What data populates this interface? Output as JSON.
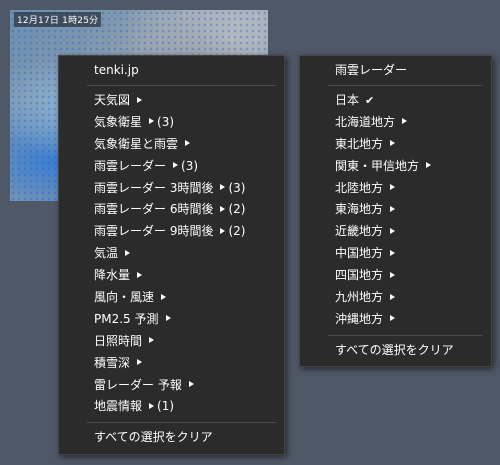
{
  "background_map": {
    "timestamp": "12月17日 1時25分"
  },
  "left_menu": {
    "header": "tenki.jp",
    "items": [
      {
        "label": "天気図",
        "count": ""
      },
      {
        "label": "気象衛星",
        "count": "(3)"
      },
      {
        "label": "気象衛星と雨雲",
        "count": ""
      },
      {
        "label": "雨雲レーダー",
        "count": "(3)"
      },
      {
        "label": "雨雲レーダー 3時間後",
        "count": "(3)"
      },
      {
        "label": "雨雲レーダー 6時間後",
        "count": "(2)"
      },
      {
        "label": "雨雲レーダー 9時間後",
        "count": "(2)"
      },
      {
        "label": "気温",
        "count": ""
      },
      {
        "label": "降水量",
        "count": ""
      },
      {
        "label": "風向・風速",
        "count": ""
      },
      {
        "label": "PM2.5 予測",
        "count": ""
      },
      {
        "label": "日照時間",
        "count": ""
      },
      {
        "label": "積雪深",
        "count": ""
      },
      {
        "label": "雷レーダー 予報",
        "count": ""
      },
      {
        "label": "地震情報",
        "count": "(1)"
      }
    ],
    "footer": "すべての選択をクリア"
  },
  "right_menu": {
    "header": "雨雲レーダー",
    "checked_item": {
      "label": "日本",
      "mark": "✔"
    },
    "items": [
      {
        "label": "北海道地方"
      },
      {
        "label": "東北地方"
      },
      {
        "label": "関東・甲信地方"
      },
      {
        "label": "北陸地方"
      },
      {
        "label": "東海地方"
      },
      {
        "label": "近畿地方"
      },
      {
        "label": "中国地方"
      },
      {
        "label": "四国地方"
      },
      {
        "label": "九州地方"
      },
      {
        "label": "沖縄地方"
      }
    ],
    "footer": "すべての選択をクリア"
  },
  "icons": {
    "submenu_arrow": "chevron-right-icon",
    "checkmark": "check-icon"
  }
}
